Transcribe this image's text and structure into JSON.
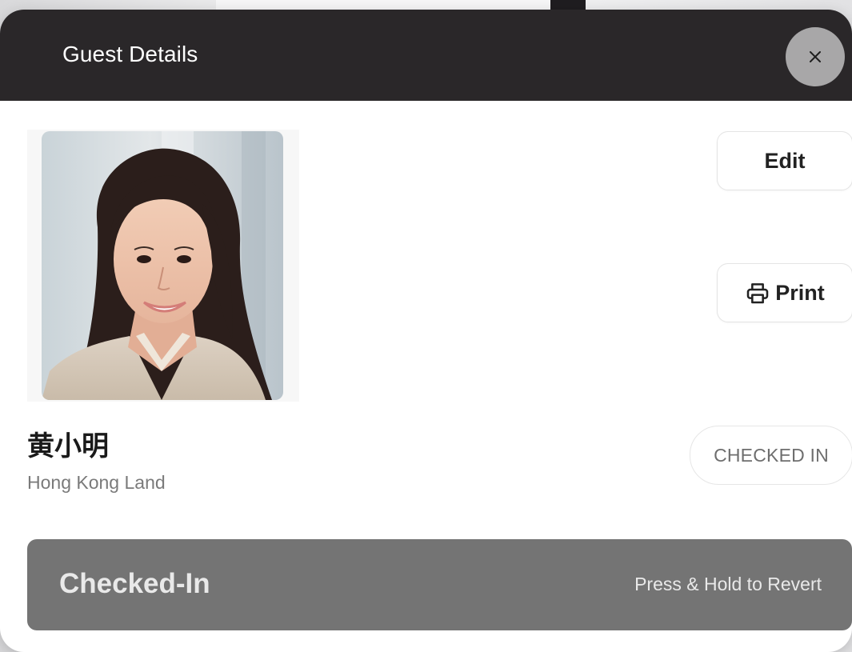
{
  "modal": {
    "title": "Guest Details",
    "close_symbol": "×"
  },
  "guest": {
    "name": "黄小明",
    "company": "Hong Kong Land",
    "photo": "guest-portrait"
  },
  "actions": {
    "edit_label": "Edit",
    "print_label": "Print",
    "print_icon": "printer-icon"
  },
  "status": {
    "badge": "CHECKED IN"
  },
  "checkin_bar": {
    "state_label": "Checked-In",
    "hint": "Press & Hold to Revert",
    "color": "#747474"
  },
  "colors": {
    "header_bg": "#2a2729",
    "close_bg": "#a8a7a8"
  }
}
